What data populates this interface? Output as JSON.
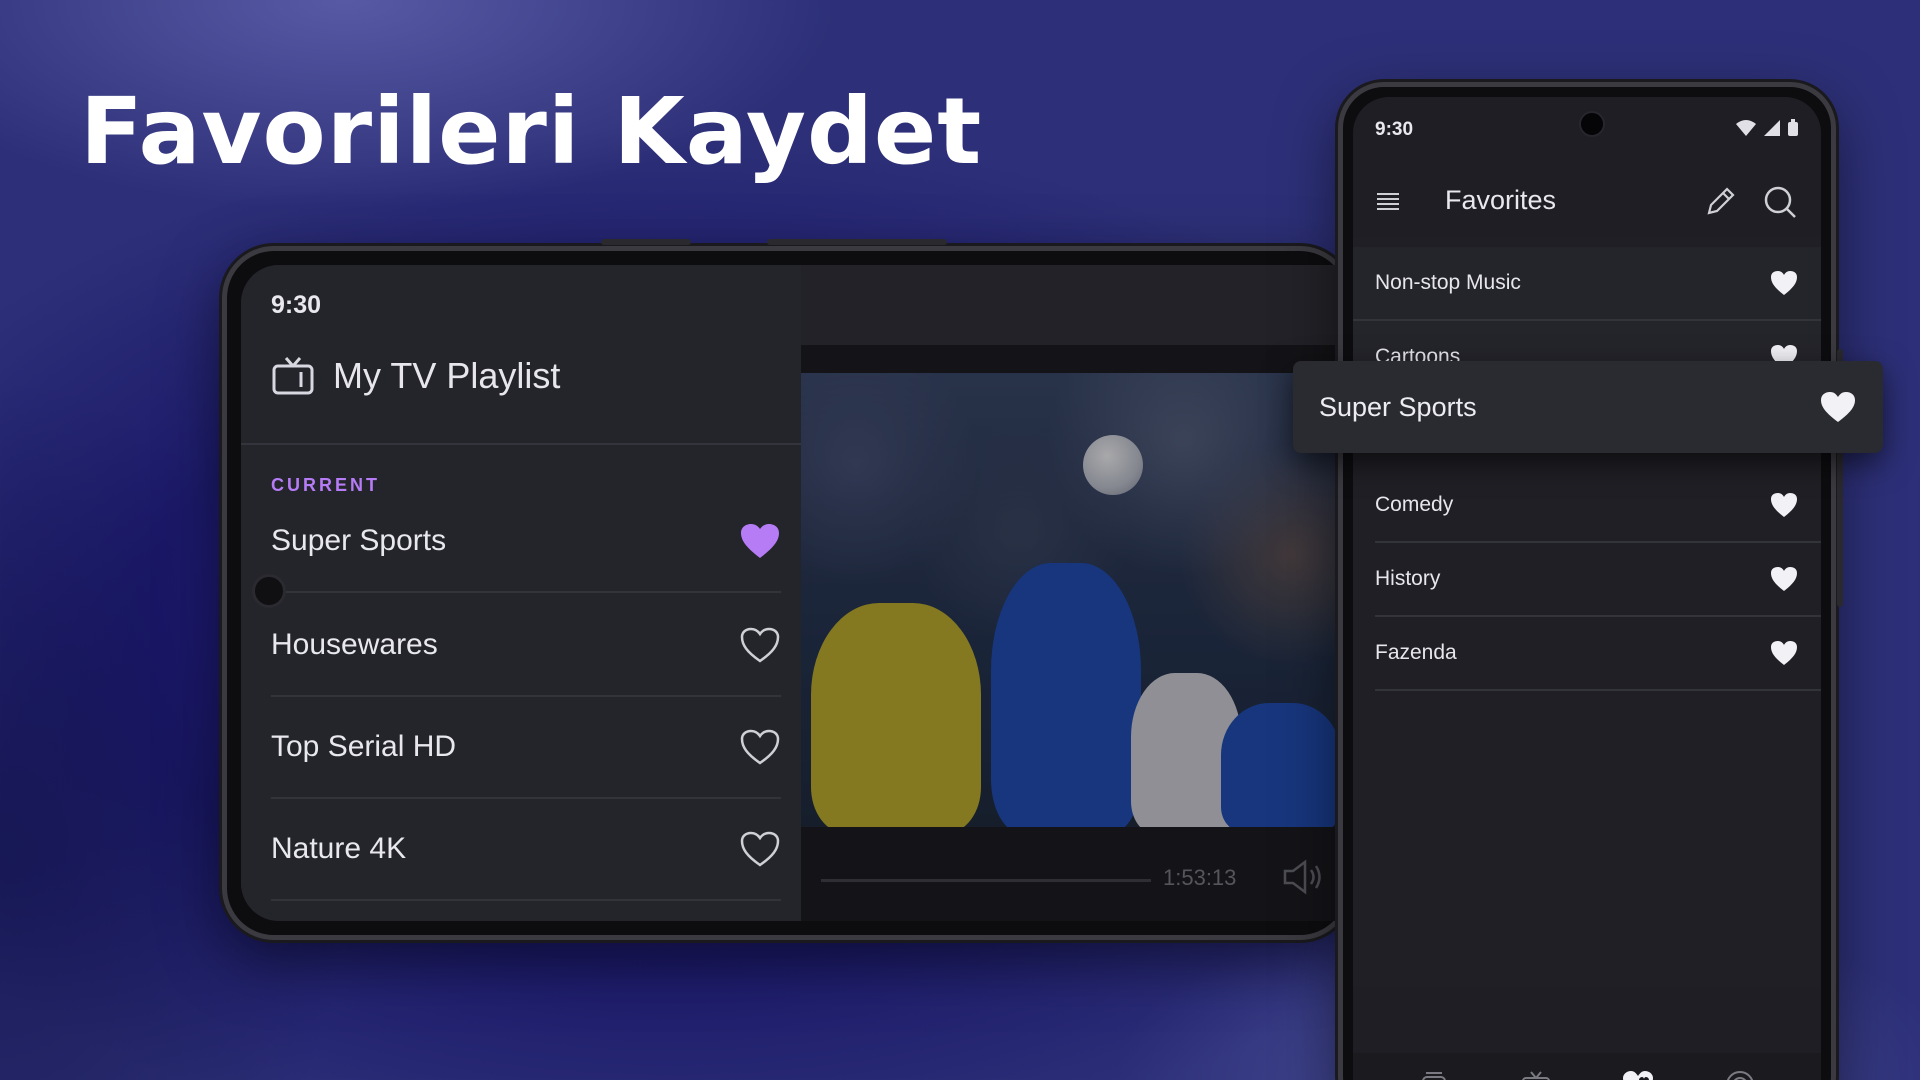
{
  "headline": "Favorileri Kaydet",
  "landscape": {
    "status_time": "9:30",
    "header_title": "My TV Playlist",
    "current_label": "CURRENT",
    "current_channel": "Super Sports",
    "channels": [
      {
        "name": "Housewares",
        "favorite": false
      },
      {
        "name": "Top Serial HD",
        "favorite": false
      },
      {
        "name": "Nature 4K",
        "favorite": false
      }
    ],
    "player": {
      "timecode": "1:53:13"
    }
  },
  "portrait": {
    "status_time": "9:30",
    "title": "Favorites",
    "favorites": [
      {
        "name": "Non-stop Music"
      },
      {
        "name": "Cartoons"
      },
      {
        "name": "Super Sports"
      },
      {
        "name": "Comedy"
      },
      {
        "name": "History"
      },
      {
        "name": "Fazenda"
      }
    ],
    "dragging_item": "Super Sports",
    "bottom_nav": [
      "media-icon",
      "tv-icon",
      "favorites-icon",
      "radio-icon"
    ],
    "active_nav": "favorites-icon"
  },
  "colors": {
    "accent": "#b57cf5",
    "background": "#20216f",
    "surface": "#24242b"
  }
}
